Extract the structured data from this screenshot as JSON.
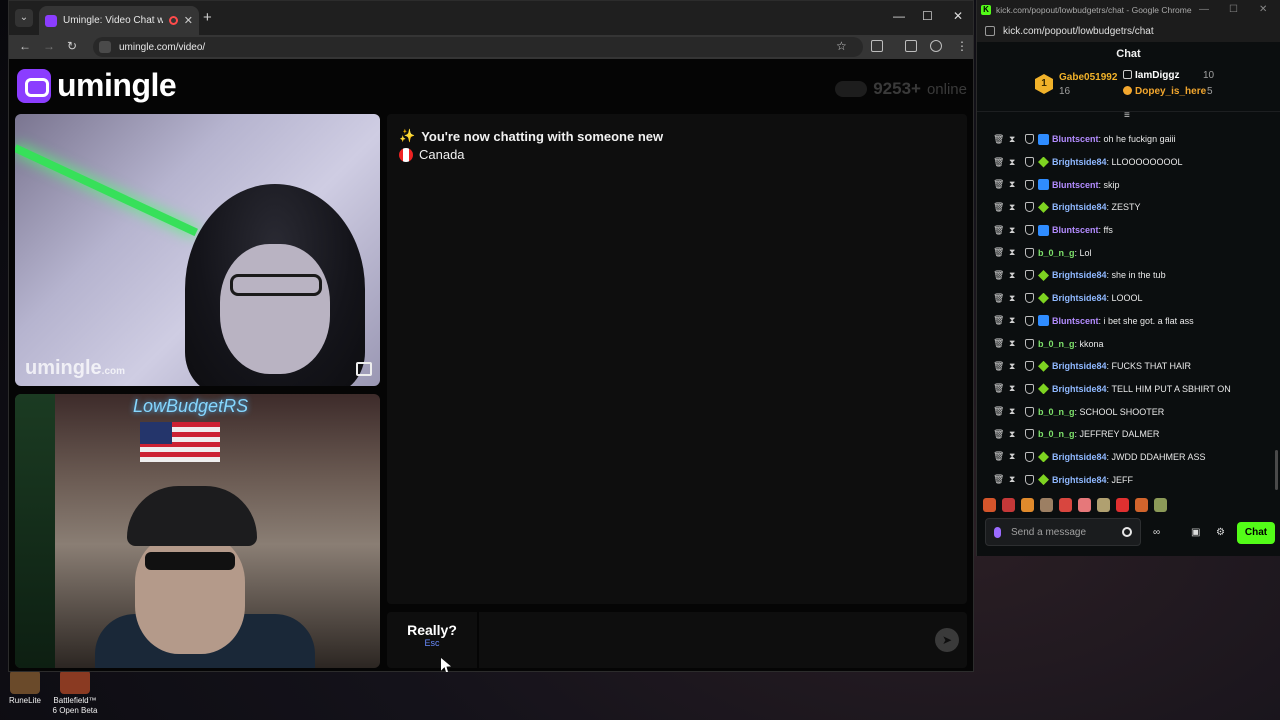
{
  "browser1": {
    "tab_title": "Umingle: Video Chat with S",
    "url": "umingle.com/video/",
    "new_tab": "+",
    "tab_close": "✕",
    "controls": {
      "minimize": "—",
      "maximize": "☐",
      "close": "✕"
    }
  },
  "umingle": {
    "logo_text": "umingle",
    "online_count": "9253+",
    "online_label": "online",
    "watermark": "umingle",
    "watermark_domain": ".com",
    "stream_neon": "LowBudgetRS",
    "system_message": "You're now chatting with someone new",
    "system_icon": "✨",
    "country": "Canada",
    "button_main": "Really?",
    "button_sub": "Esc",
    "send_icon": "➤"
  },
  "browser2": {
    "title": "kick.com/popout/lowbudgetrs/chat - Google Chrome",
    "url": "kick.com/popout/lowbudgetrs/chat",
    "chat_header": "Chat",
    "gifters": [
      {
        "name": "Gabe051992",
        "count": "16",
        "rank": "1",
        "color": "#f1b22a"
      },
      {
        "name": "IamDiggz",
        "count": "10",
        "color": "#ffffff"
      },
      {
        "name": "Dopey_is_here",
        "count": "5",
        "color": "#f3a72e"
      }
    ],
    "messages": [
      {
        "user": "Bluntscent",
        "text": "oh he fuckign gaiii",
        "color": "#b38cff",
        "badge": "blue"
      },
      {
        "user": "Brightside84",
        "text": "LLOOOOOOOOL",
        "color": "#8fb8ff",
        "badge": "green"
      },
      {
        "user": "Bluntscent",
        "text": "skip",
        "color": "#b38cff",
        "badge": "blue"
      },
      {
        "user": "Brightside84",
        "text": "ZESTY",
        "color": "#8fb8ff",
        "badge": "green"
      },
      {
        "user": "Bluntscent",
        "text": "ffs",
        "color": "#b38cff",
        "badge": "blue"
      },
      {
        "user": "b_0_n_g",
        "text": "Lol",
        "color": "#7ee36b",
        "badge": ""
      },
      {
        "user": "Brightside84",
        "text": "she in the tub",
        "color": "#8fb8ff",
        "badge": "green"
      },
      {
        "user": "Brightside84",
        "text": "LOOOL",
        "color": "#8fb8ff",
        "badge": "green"
      },
      {
        "user": "Bluntscent",
        "text": "i bet she got. a flat ass",
        "color": "#b38cff",
        "badge": "blue"
      },
      {
        "user": "b_0_n_g",
        "text": "kkona",
        "color": "#7ee36b",
        "badge": ""
      },
      {
        "user": "Brightside84",
        "text": "FUCKS THAT HAIR",
        "color": "#8fb8ff",
        "badge": "green"
      },
      {
        "user": "Brightside84",
        "text": "TELL HIM PUT A SBHIRT ON",
        "color": "#8fb8ff",
        "badge": "green"
      },
      {
        "user": "b_0_n_g",
        "text": "SCHOOL SHOOTER",
        "color": "#7ee36b",
        "badge": ""
      },
      {
        "user": "b_0_n_g",
        "text": "JEFFREY DALMER",
        "color": "#7ee36b",
        "badge": ""
      },
      {
        "user": "Brightside84",
        "text": "JWDD DDAHMER ASS",
        "color": "#8fb8ff",
        "badge": "green"
      },
      {
        "user": "Brightside84",
        "text": "JEFF",
        "color": "#8fb8ff",
        "badge": "green"
      }
    ],
    "input_placeholder": "Send a message",
    "chat_button": "Chat",
    "accent": "#53fc18"
  },
  "desktop": {
    "icons": [
      {
        "label": "RuneLite"
      },
      {
        "label": "Battlefield™ 6 Open Beta"
      }
    ]
  }
}
